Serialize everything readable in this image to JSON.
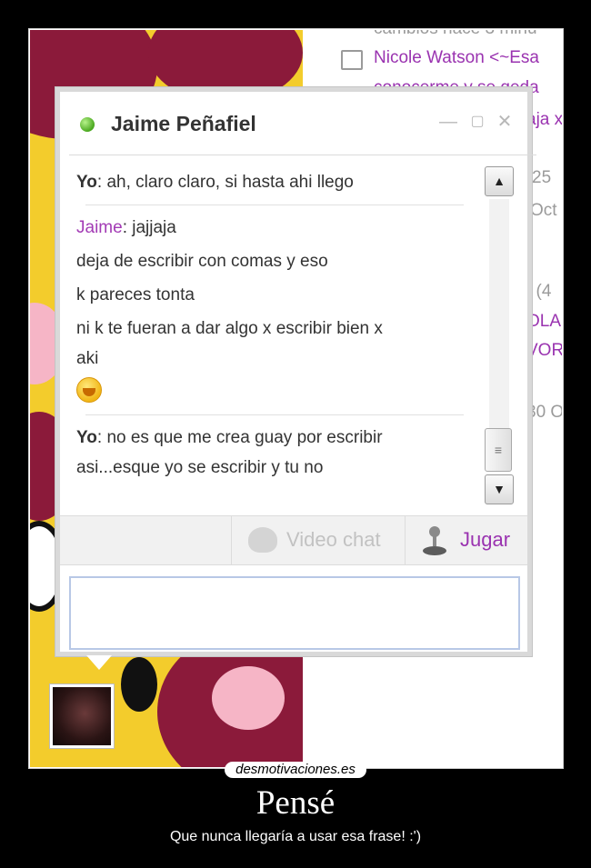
{
  "background_feed": {
    "line_top": "cambios hace 3 minu",
    "calendar_name": "Nicole Watson <~Esa",
    "line_purple_2": "conocerme y se qeda",
    "line_purple_3": "aja x",
    "date_1": "25",
    "date_2": "Oct",
    "frag_1": ". (4",
    "frag_2": "OLA",
    "frag_3": "VOR",
    "frag_4": "30 O"
  },
  "chat": {
    "contact_name": "Jaime Peñafiel",
    "status": "online",
    "window_controls": [
      "minimize-icon",
      "maximize-icon",
      "close-icon"
    ],
    "messages": [
      {
        "sender": "Yo",
        "lines": [
          "ah, claro claro, si hasta ahi llego"
        ]
      },
      {
        "sender": "Jaime",
        "lines": [
          "jajjaja",
          "deja de escribir con comas y eso",
          "k pareces tonta",
          "ni k te fueran a dar algo x escribir bien x",
          "aki"
        ],
        "emoji": "laughing-smiley"
      },
      {
        "sender": "Yo",
        "lines": [
          "no es que me crea guay por escribir",
          "asi...esque yo se escribir y tu no"
        ]
      }
    ],
    "toolbar": {
      "videochat_label": "Video chat",
      "jugar_label": "Jugar"
    },
    "input_value": ""
  },
  "poster": {
    "site": "desmotivaciones.es",
    "title": "Pensé",
    "subtitle": "Que nunca llegaría a usar esa frase! :')"
  },
  "colors": {
    "accent_purple": "#9a33b0",
    "status_green": "#4aa81f",
    "cartoon_yellow": "#f3cc2c"
  }
}
